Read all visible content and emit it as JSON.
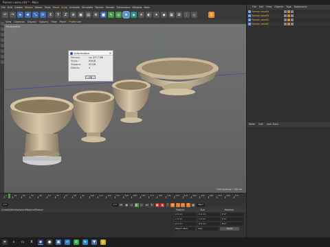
{
  "window": {
    "title": "Roman vases.c4d * - Main"
  },
  "menubar": {
    "items": [
      "File",
      "Edit",
      "Create",
      "Modes",
      "Select",
      "Tools",
      "Mesh",
      "Snap",
      "Animate",
      "Simulate",
      "Tracker",
      "Render",
      "Extensions",
      "Window",
      "Help"
    ],
    "highlighted": [
      "Modes",
      "Mesh",
      "Snap"
    ]
  },
  "viewport_menu": {
    "items": [
      "View",
      "Cameras",
      "Display",
      "Options",
      "Filter",
      "Panel",
      "ProRender"
    ]
  },
  "viewport": {
    "label": "Perspective",
    "grid_spacing": "Grid Spacing : 100 cm"
  },
  "info_dialog": {
    "title": "Information",
    "rows": [
      {
        "key": "Memory:",
        "value": "ca. 227.7 MB"
      },
      {
        "key": "Points:",
        "value": "91918"
      },
      {
        "key": "Polygons:",
        "value": "91726"
      },
      {
        "key": "Objects:",
        "value": "4"
      }
    ],
    "ok_label": "OK"
  },
  "timeline": {
    "ticks": [
      "0",
      "10",
      "20",
      "30",
      "40",
      "50",
      "60",
      "70",
      "80",
      "90",
      "100",
      "110",
      "120",
      "130",
      "140",
      "150",
      "160",
      "170",
      "180",
      "190",
      "200",
      "210",
      "220",
      "230",
      "240",
      "250",
      "260",
      "270"
    ],
    "current_frame": "0 F",
    "start_frame": "0 F",
    "end_frame": "300 F",
    "end_frame_2": "300 F"
  },
  "bottom_left_menu": [
    "Create",
    "Edit",
    "View",
    "Select",
    "Material",
    "Texture"
  ],
  "coordinates": {
    "headers": [
      "Position",
      "Size",
      "Rotation"
    ],
    "rows": [
      [
        "X  0 cm",
        "X  0 cm",
        "H  0°"
      ],
      [
        "Y  0 cm",
        "Y  0 cm",
        "P  0°"
      ],
      [
        "Z  0 cm",
        "Z  0 cm",
        "B  0°"
      ]
    ],
    "mode_left": "Object (Rel)",
    "mode_right": "Size",
    "apply_label": "Apply"
  },
  "object_manager": {
    "menu": [
      "File",
      "Edit",
      "View",
      "Objects",
      "Tags",
      "Bookmarks"
    ],
    "objects": [
      "Roman vase04",
      "Roman vase03",
      "Roman vase02",
      "Roman vase01"
    ]
  },
  "attribute_manager": {
    "menu": [
      "Mode",
      "Edit",
      "User Data"
    ]
  },
  "taskbar": {
    "icons": [
      "start-icon",
      "search-icon",
      "task-view-icon",
      "x-app-icon",
      "cinema4d-icon",
      "record-icon",
      "photos-icon",
      "vscode-icon",
      "whatsapp-icon",
      "telegram-icon",
      "vpn-icon",
      "chrome-icon"
    ]
  },
  "colors": {
    "accent": "#e8912d",
    "selection_blue": "#6aa6ff",
    "active_label": "#ffb347"
  }
}
